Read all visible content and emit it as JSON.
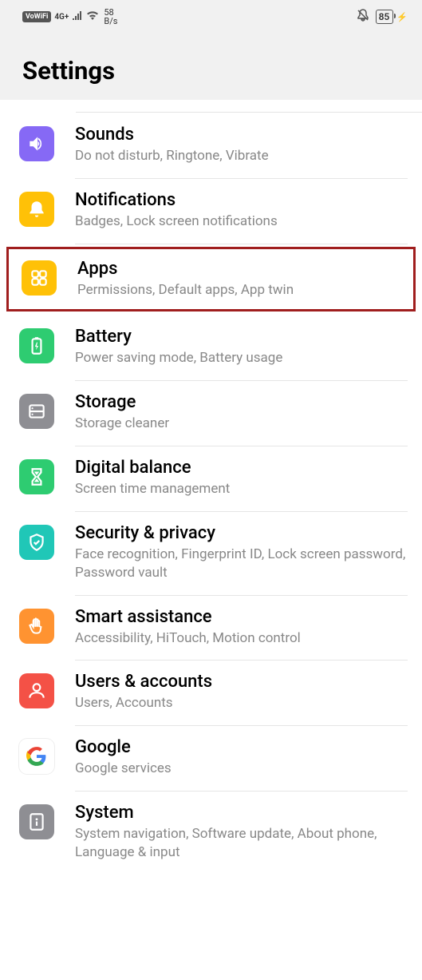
{
  "statusBar": {
    "vowifi": "VoWiFi",
    "network": "4G+",
    "speedValue": "58",
    "speedUnit": "B/s",
    "battery": "85",
    "charging": "⚡"
  },
  "header": {
    "title": "Settings"
  },
  "items": [
    {
      "title": "Sounds",
      "subtitle": "Do not disturb, Ringtone, Vibrate",
      "iconName": "sound-icon",
      "bgClass": "bg-purple"
    },
    {
      "title": "Notifications",
      "subtitle": "Badges, Lock screen notifications",
      "iconName": "bell-icon",
      "bgClass": "bg-yellow"
    },
    {
      "title": "Apps",
      "subtitle": "Permissions, Default apps, App twin",
      "iconName": "apps-icon",
      "bgClass": "bg-yellow",
      "highlight": true
    },
    {
      "title": "Battery",
      "subtitle": "Power saving mode, Battery usage",
      "iconName": "battery-icon",
      "bgClass": "bg-green"
    },
    {
      "title": "Storage",
      "subtitle": "Storage cleaner",
      "iconName": "storage-icon",
      "bgClass": "bg-gray"
    },
    {
      "title": "Digital balance",
      "subtitle": "Screen time management",
      "iconName": "hourglass-icon",
      "bgClass": "bg-green"
    },
    {
      "title": "Security & privacy",
      "subtitle": "Face recognition, Fingerprint ID, Lock screen password, Password vault",
      "iconName": "shield-icon",
      "bgClass": "bg-teal"
    },
    {
      "title": "Smart assistance",
      "subtitle": "Accessibility, HiTouch, Motion control",
      "iconName": "hand-icon",
      "bgClass": "bg-orange"
    },
    {
      "title": "Users & accounts",
      "subtitle": "Users, Accounts",
      "iconName": "user-icon",
      "bgClass": "bg-red"
    },
    {
      "title": "Google",
      "subtitle": "Google services",
      "iconName": "google-icon",
      "bgClass": "bg-google"
    },
    {
      "title": "System",
      "subtitle": "System navigation, Software update, About phone, Language & input",
      "iconName": "info-icon",
      "bgClass": "bg-gray"
    }
  ]
}
